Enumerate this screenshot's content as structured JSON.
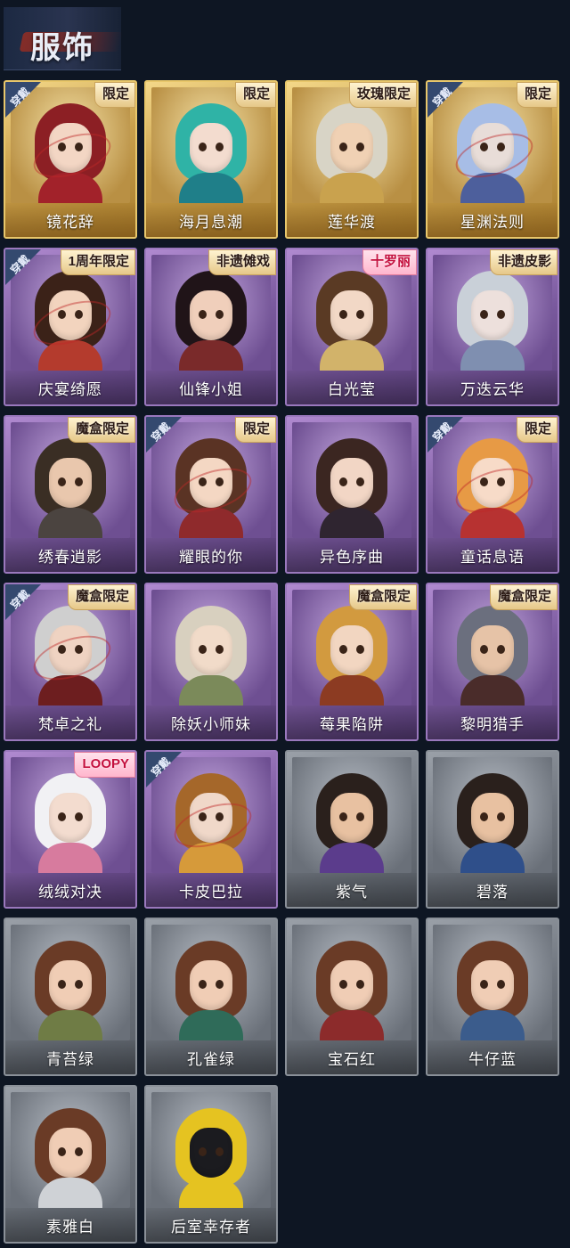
{
  "header": {
    "title": "服饰"
  },
  "items": [
    {
      "name": "镜花辞",
      "frame": "gold",
      "wearing": true,
      "badge": "限定",
      "hair": "#8c1f24",
      "outfit": "#a2222a",
      "skin": "#f3d6c4"
    },
    {
      "name": "海月息潮",
      "frame": "gold",
      "wearing": false,
      "badge": "限定",
      "hair": "#2fb3a6",
      "outfit": "#1f7f89",
      "skin": "#f3dccf"
    },
    {
      "name": "莲华渡",
      "frame": "gold",
      "wearing": false,
      "badge": "玫瑰限定",
      "hair": "#d8d4c6",
      "outfit": "#c9a24e",
      "skin": "#f0d1b4"
    },
    {
      "name": "星渊法则",
      "frame": "gold",
      "wearing": true,
      "badge": "限定",
      "hair": "#a7bde6",
      "outfit": "#4d5f9c",
      "skin": "#e8ddd8"
    },
    {
      "name": "庆宴绮愿",
      "frame": "purple",
      "wearing": true,
      "badge": "1周年限定",
      "hair": "#3b2218",
      "outfit": "#b43b2d",
      "skin": "#f2d4be"
    },
    {
      "name": "仙锋小姐",
      "frame": "purple",
      "wearing": false,
      "badge": "非遗傩戏",
      "hair": "#201418",
      "outfit": "#7a2a2a",
      "skin": "#f0cfbb"
    },
    {
      "name": "白光莹",
      "frame": "purple",
      "wearing": false,
      "badge": "十罗丽",
      "badge_style": "pink",
      "hair": "#5a3a24",
      "outfit": "#d2b36a",
      "skin": "#f2d8c6"
    },
    {
      "name": "万迭云华",
      "frame": "purple",
      "wearing": false,
      "badge": "非遗皮影",
      "hair": "#c9d0d8",
      "outfit": "#7f8fb0",
      "skin": "#ede0dc"
    },
    {
      "name": "绣春逍影",
      "frame": "purple",
      "wearing": false,
      "badge": "魔盒限定",
      "hair": "#3a2e24",
      "outfit": "#4b4440",
      "skin": "#e9c7ad"
    },
    {
      "name": "耀眼的你",
      "frame": "purple",
      "wearing": true,
      "badge": "限定",
      "hair": "#5a3324",
      "outfit": "#8f2a2c",
      "skin": "#f4d7c3"
    },
    {
      "name": "异色序曲",
      "frame": "purple",
      "wearing": false,
      "badge": "",
      "hair": "#3b2621",
      "outfit": "#2f2530",
      "skin": "#f2d6c5"
    },
    {
      "name": "童话息语",
      "frame": "purple",
      "wearing": true,
      "badge": "限定",
      "hair": "#e79a45",
      "outfit": "#b73231",
      "skin": "#f7dbc8"
    },
    {
      "name": "梵卓之礼",
      "frame": "purple",
      "wearing": true,
      "badge": "魔盒限定",
      "hair": "#cfcfcf",
      "outfit": "#6d1e1f",
      "skin": "#efd3c2"
    },
    {
      "name": "除妖小师妹",
      "frame": "purple",
      "wearing": false,
      "badge": "",
      "hair": "#d8d0bf",
      "outfit": "#7b8a5a",
      "skin": "#f1dbc9"
    },
    {
      "name": "莓果陷阱",
      "frame": "purple",
      "wearing": false,
      "badge": "魔盒限定",
      "hair": "#d29a3f",
      "outfit": "#8c3b22",
      "skin": "#f2d6c1"
    },
    {
      "name": "黎明猎手",
      "frame": "purple",
      "wearing": false,
      "badge": "魔盒限定",
      "hair": "#6b6f7e",
      "outfit": "#4a2c2a",
      "skin": "#e6c3a7"
    },
    {
      "name": "绒绒对决",
      "frame": "purple",
      "wearing": false,
      "badge": "LOOPY",
      "badge_style": "pink",
      "hair": "#f1f1f4",
      "outfit": "#d77b9e",
      "skin": "#f3dccf"
    },
    {
      "name": "卡皮巴拉",
      "frame": "purple",
      "wearing": true,
      "badge": "",
      "hair": "#a5672a",
      "outfit": "#d69a3a",
      "skin": "#f0d8c9"
    },
    {
      "name": "紫气",
      "frame": "gray",
      "wearing": false,
      "badge": "",
      "hair": "#2a201c",
      "outfit": "#5b3c8c",
      "skin": "#e8c1a1"
    },
    {
      "name": "碧落",
      "frame": "gray",
      "wearing": false,
      "badge": "",
      "hair": "#2a201c",
      "outfit": "#2f4f8a",
      "skin": "#e8c1a1"
    },
    {
      "name": "青苔绿",
      "frame": "gray",
      "wearing": false,
      "badge": "",
      "hair": "#6a3b26",
      "outfit": "#6f7c45",
      "skin": "#f0cdb5"
    },
    {
      "name": "孔雀绿",
      "frame": "gray",
      "wearing": false,
      "badge": "",
      "hair": "#6a3b26",
      "outfit": "#2f6b59",
      "skin": "#f0cdb5"
    },
    {
      "name": "宝石红",
      "frame": "gray",
      "wearing": false,
      "badge": "",
      "hair": "#6a3b26",
      "outfit": "#8c2b2b",
      "skin": "#f0cdb5"
    },
    {
      "name": "牛仔蓝",
      "frame": "gray",
      "wearing": false,
      "badge": "",
      "hair": "#6a3b26",
      "outfit": "#3b5c8c",
      "skin": "#f0cdb5"
    },
    {
      "name": "素雅白",
      "frame": "gray",
      "wearing": false,
      "badge": "",
      "hair": "#6a3b26",
      "outfit": "#cfd2d6",
      "skin": "#f0cdb5"
    },
    {
      "name": "后室幸存者",
      "frame": "gray",
      "wearing": false,
      "badge": "",
      "hair": "#e5c321",
      "outfit": "#e5c321",
      "skin": "#1b1b1f"
    }
  ],
  "labels": {
    "wearing": "穿戴"
  }
}
